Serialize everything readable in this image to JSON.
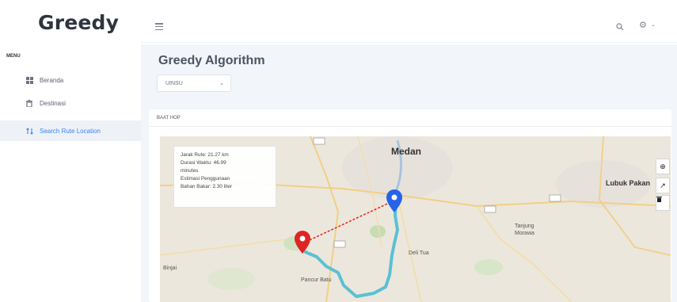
{
  "app": {
    "logo": "Greedy"
  },
  "sidebar": {
    "heading": "MENU",
    "items": [
      {
        "label": "Beranda",
        "icon": "grid-icon"
      },
      {
        "label": "Destinasi",
        "icon": "bin-icon"
      },
      {
        "label": "Search Rute Location",
        "icon": "route-icon",
        "active": true
      }
    ]
  },
  "topbar": {
    "icons": [
      "menu-icon",
      "search-icon",
      "settings-icon",
      "chevron-down-icon"
    ]
  },
  "page": {
    "title": "Greedy Algorithm",
    "select_value": "UINSU",
    "card_header": "BAAT HOP"
  },
  "map": {
    "info_lines": [
      "Jarak Rute: 21.27 km",
      "Durasi Waktu: 46.99",
      "minutes",
      "Estimasi Penggunaan",
      "Bahan Bakar: 2.30 liter"
    ],
    "labels": {
      "medan": "Medan",
      "lubuk_pakam": "Lubuk Pakan",
      "deli_tua": "Deli Tua",
      "tanjung_morawa_1": "Tanjung",
      "tanjung_morawa_2": "Morawa",
      "pancur_batu": "Pancur Batu",
      "binjai": "Binjai"
    },
    "route_color": "#5bc0d3",
    "marker_start_color": "#e02424",
    "marker_end_color": "#2563eb"
  }
}
